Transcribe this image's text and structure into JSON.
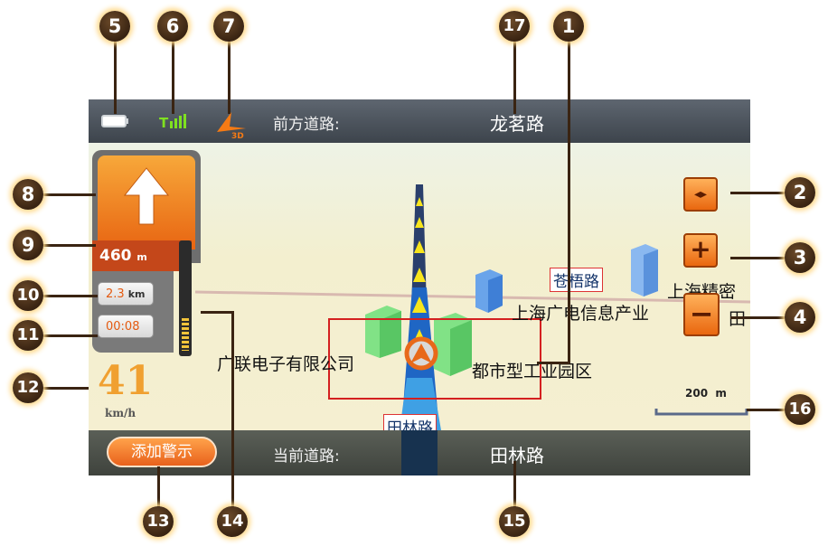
{
  "callouts": [
    "1",
    "2",
    "3",
    "4",
    "5",
    "6",
    "7",
    "8",
    "9",
    "10",
    "11",
    "12",
    "13",
    "14",
    "15",
    "16",
    "17"
  ],
  "top_bar": {
    "next_road_label": "前方道路:",
    "next_road_name": "龙茗路"
  },
  "bottom_bar": {
    "current_road_label": "当前道路:",
    "current_road_name": "田林路",
    "add_alert_button": "添加警示"
  },
  "guidance": {
    "turn_distance": "460",
    "turn_distance_unit": "m",
    "remaining_distance": "2.3",
    "remaining_distance_unit": "km",
    "remaining_time": "00:08"
  },
  "speed": {
    "value": "41",
    "unit": "km/h"
  },
  "map": {
    "road_labels": [
      "苍梧路",
      "田林路"
    ],
    "pois": [
      "上海广电信息产业",
      "广联电子有限公司",
      "都市型工业园区",
      "上海精密",
      "田"
    ],
    "scale_value": "200",
    "scale_unit": "m",
    "view_mode_badge": "3D"
  },
  "buttons": {
    "volume": "◂▸",
    "zoom_in": "+",
    "zoom_out": "−"
  },
  "colors": {
    "accent_orange": "#e9670f",
    "top_bar": "#4f565e",
    "bottom_bar": "#4a4e47",
    "map_background": "#f5efd1",
    "callout_marker": "#3a2412"
  }
}
